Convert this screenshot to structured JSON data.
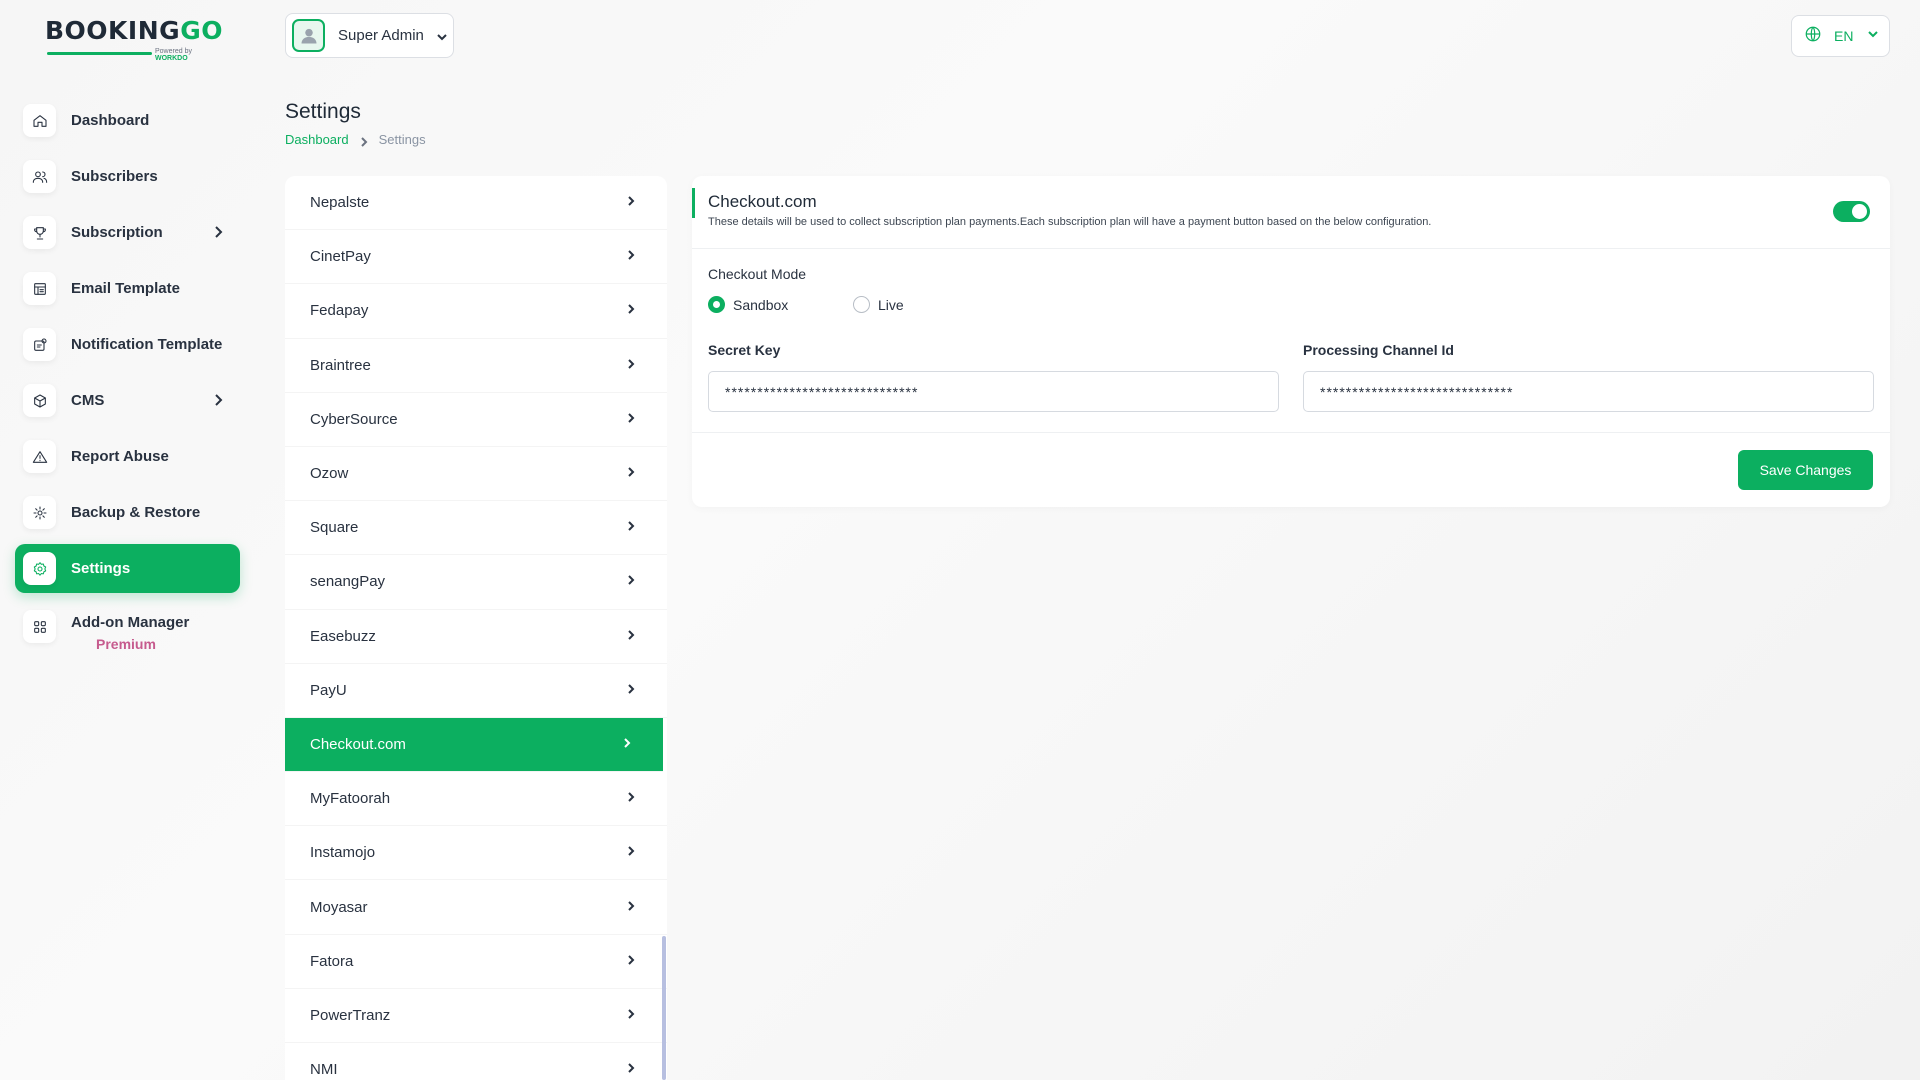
{
  "brand": {
    "logo_main": "BOOKING",
    "logo_accent": "GO",
    "logo_sub_prefix": "Powered by ",
    "logo_sub_brand": "WORKDO"
  },
  "topbar": {
    "user_name": "Super Admin",
    "language": "EN"
  },
  "sidebar": {
    "items": [
      {
        "label": "Dashboard",
        "icon": "home-icon"
      },
      {
        "label": "Subscribers",
        "icon": "users-icon"
      },
      {
        "label": "Subscription",
        "icon": "trophy-icon",
        "has_submenu": true
      },
      {
        "label": "Email Template",
        "icon": "template-icon"
      },
      {
        "label": "Notification Template",
        "icon": "notification-icon"
      },
      {
        "label": "CMS",
        "icon": "cube-icon",
        "has_submenu": true
      },
      {
        "label": "Report Abuse",
        "icon": "alert-triangle-icon"
      },
      {
        "label": "Backup & Restore",
        "icon": "backup-icon"
      },
      {
        "label": "Settings",
        "icon": "gear-icon",
        "active": true
      },
      {
        "label": "Add-on Manager",
        "icon": "apps-icon",
        "badge": "Premium"
      }
    ]
  },
  "page": {
    "title": "Settings",
    "breadcrumb": {
      "home": "Dashboard",
      "current": "Settings"
    }
  },
  "settings_list": {
    "items": [
      "Nepalste",
      "CinetPay",
      "Fedapay",
      "Braintree",
      "CyberSource",
      "Ozow",
      "Square",
      "senangPay",
      "Easebuzz",
      "PayU",
      "Checkout.com",
      "MyFatoorah",
      "Instamojo",
      "Moyasar",
      "Fatora",
      "PowerTranz",
      "NMI"
    ],
    "active": "Checkout.com"
  },
  "form": {
    "title": "Checkout.com",
    "description": "These details will be used to collect subscription plan payments.Each subscription plan will have a payment button based on the below configuration.",
    "enabled": true,
    "mode_label": "Checkout Mode",
    "modes": [
      {
        "label": "Sandbox",
        "selected": true
      },
      {
        "label": "Live",
        "selected": false
      }
    ],
    "secret_key_label": "Secret Key",
    "secret_key_value": "******************************",
    "channel_label": "Processing Channel Id",
    "channel_value": "******************************",
    "save_label": "Save Changes"
  },
  "colors": {
    "accent": "#0caf60",
    "premium": "#c65b8e",
    "text": "#293240"
  }
}
